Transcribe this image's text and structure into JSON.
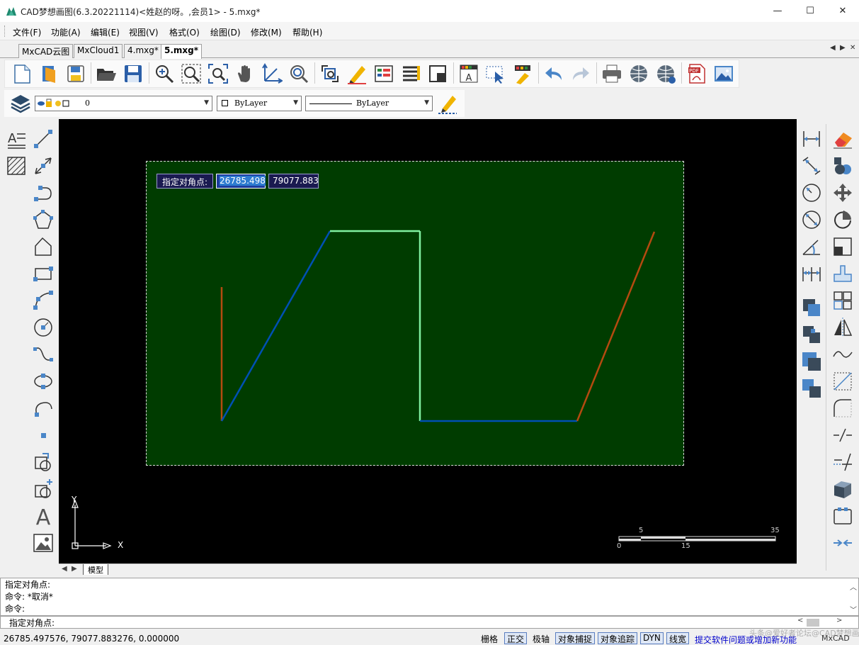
{
  "window": {
    "title": "CAD梦想画图(6.3.20221114)<姓赵的呀。,会员1> - 5.mxg*",
    "minimize": "—",
    "maximize": "☐",
    "close": "✕"
  },
  "menu": [
    "文件(F)",
    "功能(A)",
    "编辑(E)",
    "视图(V)",
    "格式(O)",
    "绘图(D)",
    "修改(M)",
    "帮助(H)"
  ],
  "tabs": [
    {
      "label": "MxCAD云图",
      "active": false
    },
    {
      "label": "MxCloud1",
      "active": false
    },
    {
      "label": "4.mxg*",
      "active": false
    },
    {
      "label": "5.mxg*",
      "active": true
    }
  ],
  "tab_nav": {
    "left": "◀",
    "right": "▶",
    "close": "✕"
  },
  "layer_bar": {
    "layer_value": "0",
    "color_value": "ByLayer",
    "linetype_value": "ByLayer"
  },
  "dynamic_input": {
    "prompt": "指定对角点:",
    "x_value": "26785.498",
    "y_value": "79077.883"
  },
  "ucs": {
    "x_label": "X",
    "y_label": "Y"
  },
  "scale_bar": {
    "labels": [
      "5",
      "35",
      "0",
      "15"
    ]
  },
  "layout": {
    "tab_label": "模型"
  },
  "command_history": [
    "指定对角点:",
    "命令:  *取消*",
    "命令:"
  ],
  "command_prompt": "指定对角点:",
  "status": {
    "coordinates": "26785.497576,  79077.883276,  0.000000",
    "toggles": [
      {
        "label": "栅格",
        "on": false
      },
      {
        "label": "正交",
        "on": true
      },
      {
        "label": "极轴",
        "on": false
      },
      {
        "label": "对象捕捉",
        "on": true
      },
      {
        "label": "对象追踪",
        "on": true
      },
      {
        "label": "DYN",
        "on": true
      },
      {
        "label": "线宽",
        "on": true
      }
    ],
    "feedback_link": "提交软件问题或增加新功能",
    "brand": "MxCAD",
    "watermark": "头条@爱好者论坛@CAD梦想画图"
  },
  "colors": {
    "canvas_bg": "#000000",
    "selection_fill": "#003c00",
    "line_blue": "#0050b4",
    "line_orange": "#b44a10",
    "line_green": "#80f0a0",
    "link": "#0000cc"
  }
}
